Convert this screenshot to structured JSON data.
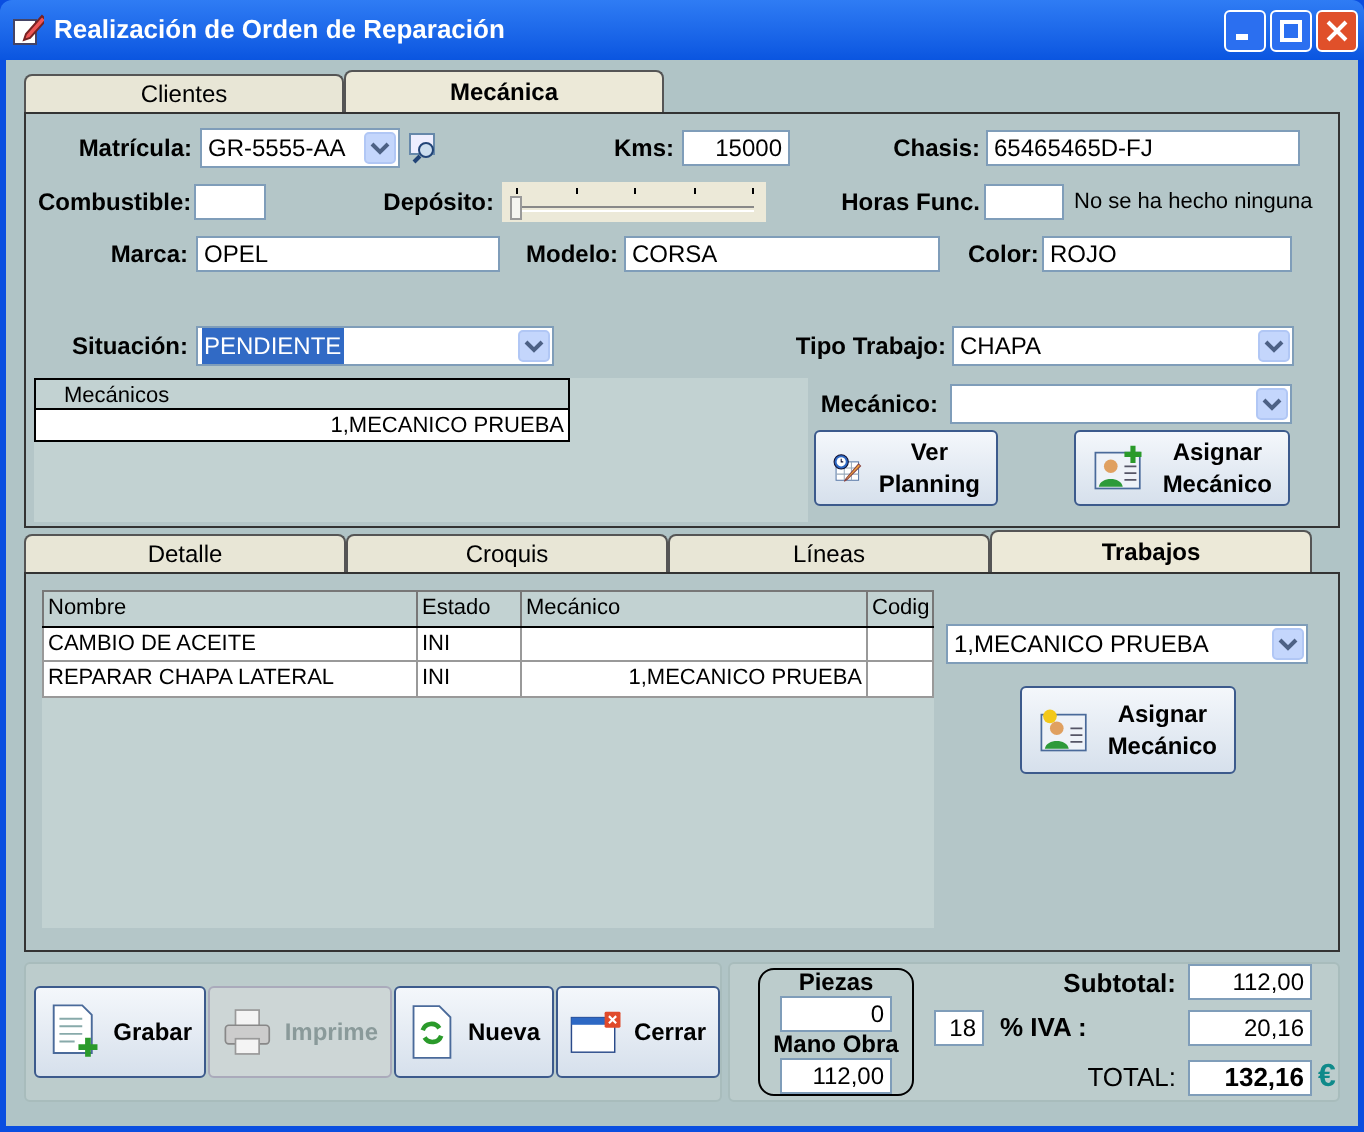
{
  "window": {
    "title": "Realización de Orden de Reparación"
  },
  "top_tabs": [
    {
      "label": "Clientes",
      "selected": false
    },
    {
      "label": "Mecánica",
      "selected": true
    }
  ],
  "matricula": {
    "label": "Matrícula:",
    "value": "GR-5555-AA"
  },
  "kms": {
    "label": "Kms:",
    "value": "15000"
  },
  "chasis": {
    "label": "Chasis:",
    "value": "65465465D-FJ"
  },
  "combustible": {
    "label": "Combustible:"
  },
  "deposito": {
    "label": "Depósito:",
    "level": 0
  },
  "horas": {
    "label": "Horas Func.",
    "note": "No se ha hecho ninguna"
  },
  "marca": {
    "label": "Marca:",
    "value": "OPEL"
  },
  "modelo": {
    "label": "Modelo:",
    "value": "CORSA"
  },
  "color": {
    "label": "Color:",
    "value": "ROJO"
  },
  "situacion": {
    "label": "Situación:",
    "value": "PENDIENTE",
    "highlighted": true
  },
  "tipo_trabajo": {
    "label": "Tipo Trabajo:",
    "value": "CHAPA"
  },
  "mecanico": {
    "label": "Mecánico:"
  },
  "mecanicos_table": {
    "column": "Mecánicos",
    "rows": [
      "1,MECANICO PRUEBA"
    ]
  },
  "top_buttons": [
    {
      "lines": [
        "Ver",
        "Planning"
      ],
      "kind": "planning"
    },
    {
      "lines": [
        "Asignar",
        "Mecánico"
      ],
      "kind": "assign"
    }
  ],
  "lower_tabs": [
    {
      "label": "Detalle",
      "selected": false
    },
    {
      "label": "Croquis",
      "selected": false
    },
    {
      "label": "Líneas",
      "selected": false
    },
    {
      "label": "Trabajos",
      "selected": true
    }
  ],
  "jobs_table": {
    "columns": [
      "Nombre",
      "Estado",
      "Mecánico",
      "Codig"
    ],
    "rows": [
      [
        "CAMBIO DE ACEITE",
        "INI",
        "",
        ""
      ],
      [
        "REPARAR CHAPA LATERAL",
        "INI",
        "1,MECANICO PRUEBA",
        ""
      ]
    ]
  },
  "job_mechanic": {
    "value": "1,MECANICO PRUEBA"
  },
  "job_assign_button": {
    "lines": [
      "Asignar",
      "Mecánico"
    ],
    "kind": "assign_job"
  },
  "footer_buttons": [
    {
      "label": "Grabar",
      "kind": "save",
      "disabled": false
    },
    {
      "label": "Imprime",
      "kind": "print",
      "disabled": true
    },
    {
      "label": "Nueva",
      "kind": "new",
      "disabled": false
    },
    {
      "label": "Cerrar",
      "kind": "close",
      "disabled": false
    }
  ],
  "piezas": {
    "label": "Piezas",
    "value": "0"
  },
  "mano_obra": {
    "label": "Mano Obra",
    "value": "112,00"
  },
  "subtotal": {
    "label": "Subtotal:",
    "value": "112,00"
  },
  "iva": {
    "rate": "18",
    "label": "% IVA :",
    "value": "20,16"
  },
  "total": {
    "label": "TOTAL:",
    "value": "132,16",
    "currency": "€"
  }
}
